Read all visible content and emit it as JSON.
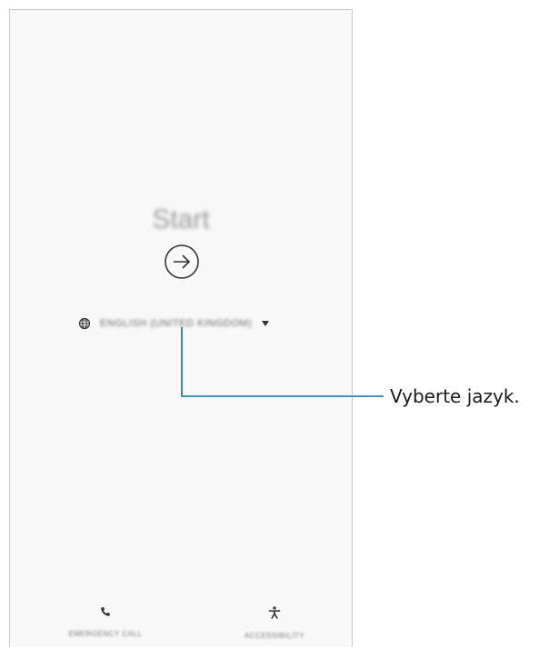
{
  "welcome_screen": {
    "title": "Start",
    "start_button_icon": "arrow-right-circle-icon",
    "language": {
      "icon": "globe-icon",
      "selected_value": "ENGLISH (UNITED KINGDOM)",
      "dropdown_icon": "triangle-down-icon"
    },
    "bottom_bar": {
      "emergency_call": {
        "icon": "phone-icon",
        "label": "EMERGENCY CALL"
      },
      "accessibility": {
        "icon": "accessibility-icon",
        "label": "ACCESSIBILITY"
      }
    }
  },
  "annotation": {
    "callout_text": "Vyberte jazyk.",
    "line_color": "#0a6fa8"
  },
  "colors": {
    "screen_background": "#f8f8f8",
    "icon_color": "#333333"
  }
}
